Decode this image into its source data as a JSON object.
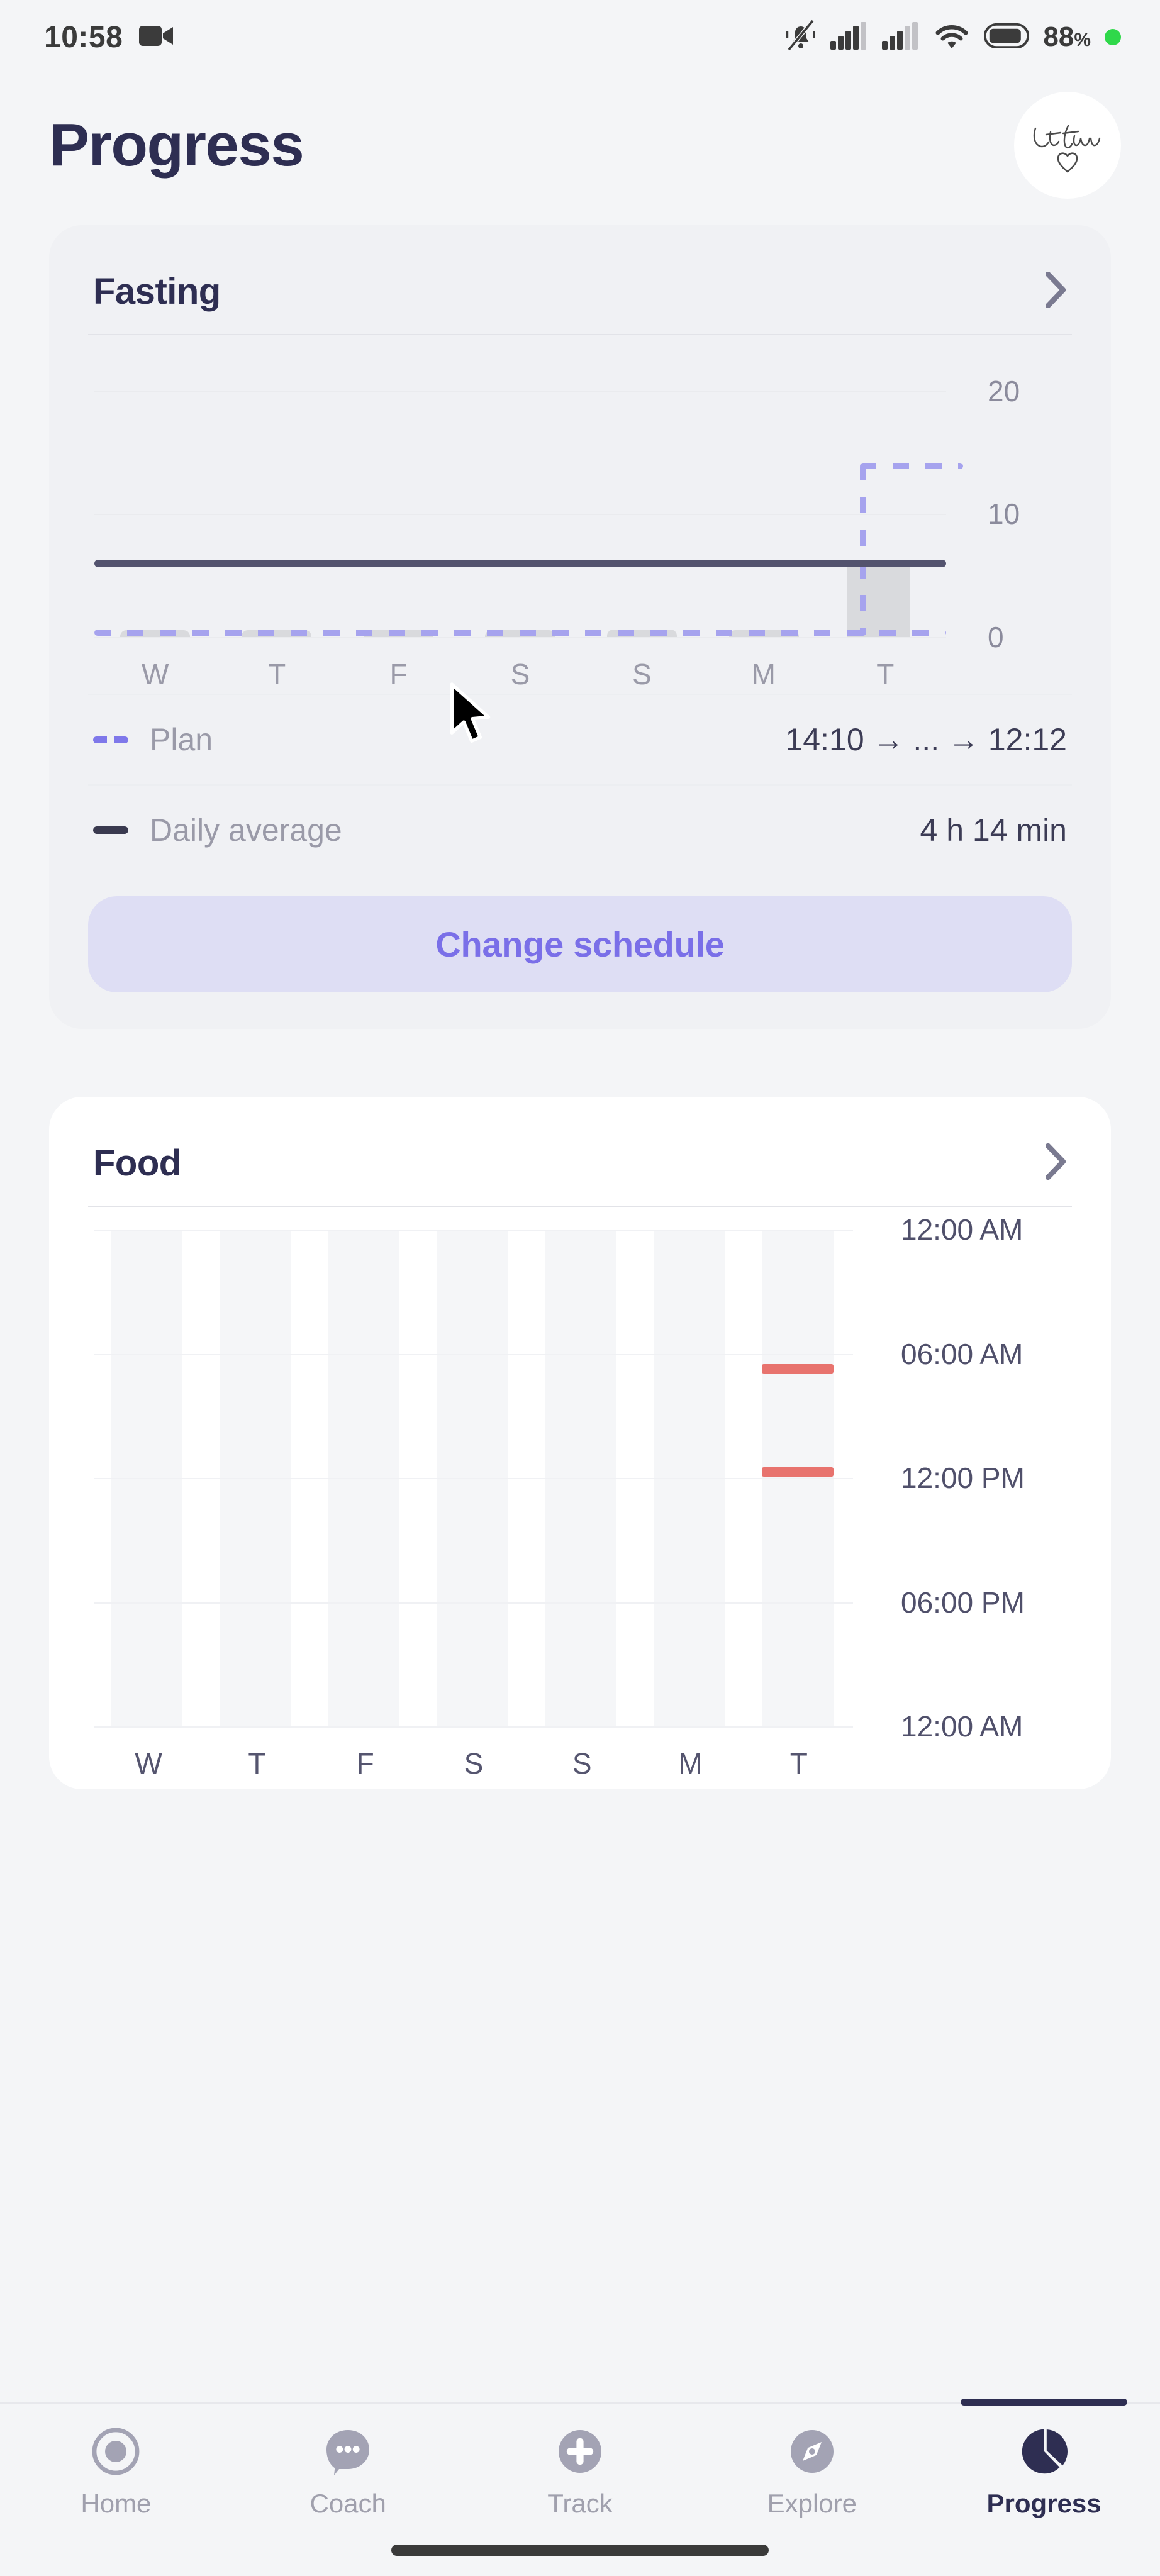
{
  "statusbar": {
    "time": "10:58",
    "video_icon": "video-camera-icon",
    "mute_icon": "bell-muted-icon",
    "signal1_icon": "cellular-signal-icon",
    "signal2_icon": "cellular-signal-icon",
    "wifi_icon": "wifi-icon",
    "battery_icon": "battery-icon",
    "battery_pct": "88",
    "battery_pct_sign": "%",
    "recording_dot": "green-recording-dot"
  },
  "header": {
    "title": "Progress",
    "avatar_line1": "Let them",
    "avatar_line2": "heart"
  },
  "fasting_card": {
    "title": "Fasting",
    "chevron": "chevron-right-icon",
    "plan": {
      "label": "Plan",
      "value": "14:10 → ... → 12:12"
    },
    "daily_average": {
      "label": "Daily average",
      "value": "4 h 14 min"
    },
    "change_schedule_label": "Change schedule"
  },
  "food_card": {
    "title": "Food",
    "chevron": "chevron-right-icon"
  },
  "bottomnav": {
    "items": [
      {
        "label": "Home",
        "icon": "target-circle-icon",
        "active": false
      },
      {
        "label": "Coach",
        "icon": "chat-bubble-icon",
        "active": false
      },
      {
        "label": "Track",
        "icon": "plus-circle-icon",
        "active": false
      },
      {
        "label": "Explore",
        "icon": "compass-icon",
        "active": false
      },
      {
        "label": "Progress",
        "icon": "pie-chart-icon",
        "active": true
      }
    ]
  },
  "colors": {
    "accent_purple": "#7a6fe8",
    "plan_dash": "#a6a3ee",
    "avg_line": "#53536e",
    "bar_gray": "#d9dadd",
    "food_marker_red": "#e8736e",
    "title_navy": "#2e2e52",
    "page_bg": "#f4f5f7",
    "card_gray": "#f0f1f4",
    "card_white": "#ffffff",
    "button_bg": "#dedef4"
  },
  "chart_data": [
    {
      "id": "fasting-chart",
      "type": "bar",
      "title": "Fasting",
      "categories": [
        "W",
        "T",
        "F",
        "S",
        "S",
        "M",
        "T"
      ],
      "values": [
        0.55,
        0.55,
        0.6,
        0.55,
        0.6,
        0.55,
        6.3
      ],
      "ylabel": "hours",
      "ylim": [
        0,
        22
      ],
      "yticks": [
        0,
        10,
        20
      ],
      "ytick_labels": [
        "0",
        "10",
        "20"
      ],
      "grid": true,
      "annotations": [
        {
          "name": "daily-average-line",
          "type": "hline",
          "value": 6.3,
          "label": "Daily average",
          "display": "4 h 14 min",
          "color": "#53536e"
        },
        {
          "name": "plan-dashed-baseline",
          "type": "hline-dashed",
          "value": 0.15,
          "label": "Plan",
          "color": "#a6a3ee"
        },
        {
          "name": "plan-dashed-riser",
          "type": "vline-dashed",
          "at_category": "T",
          "from": 0.15,
          "to": 14,
          "color": "#a6a3ee"
        },
        {
          "name": "plan-dashed-top",
          "type": "hline-dashed-segment",
          "value": 14,
          "from_category": "T",
          "color": "#a6a3ee"
        }
      ],
      "legend": [
        {
          "label": "Plan",
          "value": "14:10 → ... → 12:12",
          "style": "dashed",
          "color": "#7f78ea"
        },
        {
          "label": "Daily average",
          "value": "4 h 14 min",
          "style": "solid",
          "color": "#3a3a4f"
        }
      ]
    },
    {
      "id": "food-chart",
      "type": "scatter",
      "title": "Food",
      "categories": [
        "W",
        "T",
        "F",
        "S",
        "S",
        "M",
        "T"
      ],
      "ylabel": "time of day",
      "yticks": [
        0,
        6,
        12,
        18,
        24
      ],
      "ytick_labels": [
        "12:00 AM",
        "06:00 AM",
        "12:00 PM",
        "06:00 PM",
        "12:00 AM"
      ],
      "ylim": [
        0,
        24
      ],
      "grid": true,
      "series": [
        {
          "name": "meals",
          "color": "#e8736e",
          "points": [
            {
              "category": "T",
              "index": 6,
              "time": 6.5,
              "label": "06:30 AM"
            },
            {
              "category": "T",
              "index": 6,
              "time": 11.5,
              "label": "11:30 AM"
            }
          ]
        }
      ]
    }
  ]
}
